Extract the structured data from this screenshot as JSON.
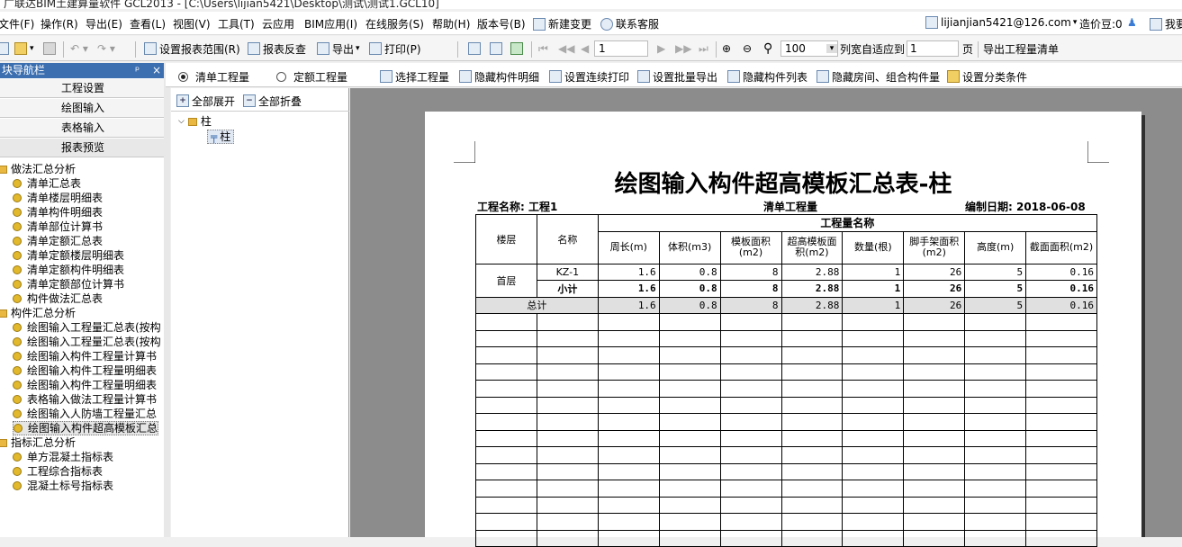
{
  "window": {
    "title": "广联达BIM土建算量软件 GCL2013 - [C:\\Users\\lijian5421\\Desktop\\测试\\测试1.GCL10]"
  },
  "menu": [
    "文件(F)",
    "操作(R)",
    "导出(E)",
    "查看(L)",
    "视图(V)",
    "工具(T)",
    "云应用",
    "BIM应用(I)",
    "在线服务(S)",
    "帮助(H)",
    "版本号(B)",
    "新建变更",
    "联系客服"
  ],
  "account": {
    "email": "lijianjian5421@126.com",
    "beans_label": "造价豆:0",
    "extra": "我要"
  },
  "toolbar": {
    "set_range": "设置报表范围(R)",
    "check": "报表反查",
    "export": "导出",
    "print": "打印(P)",
    "page": "1",
    "zoom": "100",
    "fit_label": "列宽自适应到",
    "fit_value": "1",
    "page_unit": "页",
    "export_list": "导出工程量清单"
  },
  "nav": {
    "header": "块导航栏",
    "pin": "ᵖ",
    "close": "×",
    "buttons": [
      "工程设置",
      "绘图输入",
      "表格输入",
      "报表预览"
    ]
  },
  "tree": {
    "groups": [
      {
        "label": "做法汇总分析",
        "items": [
          "清单汇总表",
          "清单楼层明细表",
          "清单构件明细表",
          "清单部位计算书",
          "清单定额汇总表",
          "清单定额楼层明细表",
          "清单定额构件明细表",
          "清单定额部位计算书",
          "构件做法汇总表"
        ]
      },
      {
        "label": "构件汇总分析",
        "items": [
          "绘图输入工程量汇总表(按构",
          "绘图输入工程量汇总表(按构",
          "绘图输入构件工程量计算书",
          "绘图输入构件工程量明细表",
          "绘图输入构件工程量明细表",
          "表格输入做法工程量计算书",
          "绘图输入人防墙工程量汇总",
          "绘图输入构件超高模板汇总"
        ]
      },
      {
        "label": "指标汇总分析",
        "items": [
          "单方混凝土指标表",
          "工程综合指标表",
          "混凝土标号指标表"
        ]
      }
    ]
  },
  "mode": {
    "option1": "清单工程量",
    "option2": "定额工程量"
  },
  "actions": [
    "选择工程量",
    "隐藏构件明细",
    "设置连续打印",
    "设置批量导出",
    "隐藏构件列表",
    "隐藏房间、组合构件量",
    "设置分类条件"
  ],
  "component_tree": {
    "expand_all": "全部展开",
    "collapse_all": "全部折叠",
    "root": "柱",
    "child": "柱"
  },
  "report": {
    "title": "绘图输入构件超高模板汇总表-柱",
    "project_label": "工程名称: 工程1",
    "qty_type": "清单工程量",
    "date_label": "编制日期: 2018-06-08",
    "headers": {
      "floor": "楼层",
      "name": "名称",
      "group": "工程量名称",
      "cols": [
        "周长(m)",
        "体积(m3)",
        "模板面积(m2)",
        "超高模板面积(m2)",
        "数量(根)",
        "脚手架面积(m2)",
        "高度(m)",
        "截面面积(m2)"
      ]
    },
    "rows": [
      {
        "floor": "首层",
        "name": "KZ-1",
        "vals": [
          "1.6",
          "0.8",
          "8",
          "2.88",
          "1",
          "26",
          "5",
          "0.16"
        ]
      },
      {
        "floor": "",
        "name": "小计",
        "vals": [
          "1.6",
          "0.8",
          "8",
          "2.88",
          "1",
          "26",
          "5",
          "0.16"
        ]
      }
    ],
    "total": {
      "label": "总计",
      "vals": [
        "1.6",
        "0.8",
        "8",
        "2.88",
        "1",
        "26",
        "5",
        "0.16"
      ]
    }
  }
}
